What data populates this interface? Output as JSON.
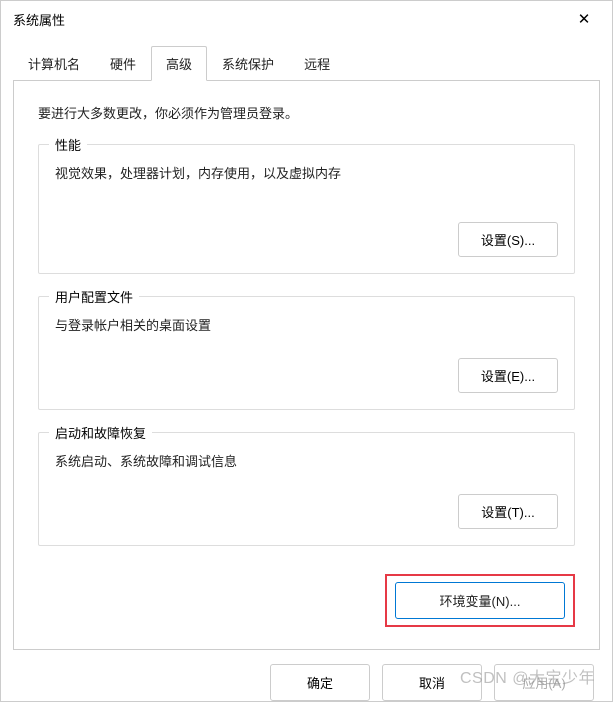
{
  "title": "系统属性",
  "tabs": {
    "computerName": "计算机名",
    "hardware": "硬件",
    "advanced": "高级",
    "systemProtection": "系统保护",
    "remote": "远程"
  },
  "advancedPanel": {
    "adminNotice": "要进行大多数更改，你必须作为管理员登录。",
    "performance": {
      "legend": "性能",
      "desc": "视觉效果，处理器计划，内存使用，以及虚拟内存",
      "button": "设置(S)..."
    },
    "userProfiles": {
      "legend": "用户配置文件",
      "desc": "与登录帐户相关的桌面设置",
      "button": "设置(E)..."
    },
    "startup": {
      "legend": "启动和故障恢复",
      "desc": "系统启动、系统故障和调试信息",
      "button": "设置(T)..."
    },
    "envVars": {
      "button": "环境变量(N)..."
    }
  },
  "footer": {
    "ok": "确定",
    "cancel": "取消",
    "apply": "应用(A)"
  },
  "watermark": "CSDN @大宝少年"
}
